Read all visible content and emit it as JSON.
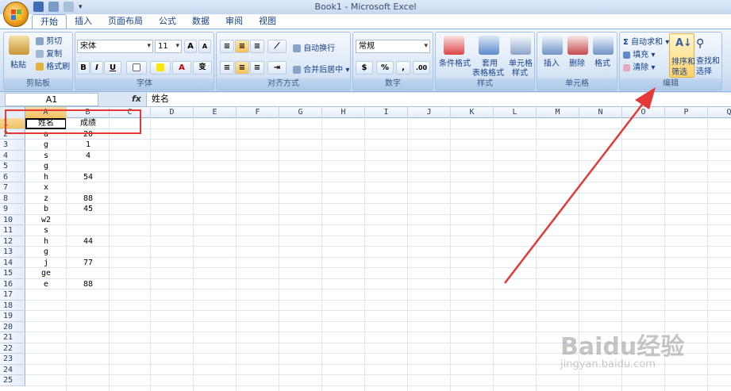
{
  "window": {
    "title": "Book1 - Microsoft Excel"
  },
  "tabs": [
    "开始",
    "插入",
    "页面布局",
    "公式",
    "数据",
    "审阅",
    "视图"
  ],
  "ribbon": {
    "clipboard": {
      "label": "剪贴板",
      "paste": "粘贴",
      "cut": "剪切",
      "copy": "复制",
      "format_painter": "格式刷"
    },
    "font": {
      "label": "字体",
      "font_name": "宋体",
      "font_size": "11",
      "bold": "B",
      "italic": "I",
      "underline": "U",
      "grow": "A",
      "shrink": "A",
      "phonetic": "变"
    },
    "alignment": {
      "label": "对齐方式",
      "wrap": "自动换行",
      "merge": "合并后居中"
    },
    "number": {
      "label": "数字",
      "format": "常规",
      "percent": "%",
      "comma": ","
    },
    "styles": {
      "label": "样式",
      "cond": "条件格式",
      "table1": "套用",
      "table2": "表格格式",
      "cell1": "单元格",
      "cell2": "样式"
    },
    "cells": {
      "label": "单元格",
      "insert": "插入",
      "delete": "删除",
      "format": "格式"
    },
    "editing": {
      "label": "编辑",
      "autosum": "自动求和",
      "fill": "填充",
      "clear": "清除",
      "sort1": "排序和",
      "sort2": "筛选",
      "find1": "查找和",
      "find2": "选择"
    }
  },
  "formula_bar": {
    "name_box": "A1",
    "fx": "fx",
    "content": "姓名"
  },
  "columns": [
    "A",
    "B",
    "C",
    "D",
    "E",
    "F",
    "G",
    "H",
    "I",
    "J",
    "K",
    "L",
    "M",
    "N",
    "O",
    "P",
    "Q"
  ],
  "rows": [
    [
      "姓名",
      "成绩"
    ],
    [
      "a",
      "20"
    ],
    [
      "g",
      "1"
    ],
    [
      "s",
      "4"
    ],
    [
      "g",
      ""
    ],
    [
      "h",
      "54"
    ],
    [
      "x",
      ""
    ],
    [
      "z",
      "88"
    ],
    [
      "b",
      "45"
    ],
    [
      "w2",
      ""
    ],
    [
      "s",
      ""
    ],
    [
      "h",
      "44"
    ],
    [
      "g",
      ""
    ],
    [
      "j",
      "77"
    ],
    [
      "ge",
      ""
    ],
    [
      "e",
      "88"
    ],
    [
      "",
      ""
    ],
    [
      "",
      ""
    ],
    [
      "",
      ""
    ],
    [
      "",
      ""
    ],
    [
      "",
      ""
    ],
    [
      "",
      ""
    ],
    [
      "",
      ""
    ],
    [
      "",
      ""
    ],
    [
      "",
      ""
    ]
  ],
  "watermark": {
    "brand": "Baidu经验",
    "url": "jingyan.baidu.com"
  },
  "colors": {
    "annotation": "#e53935",
    "selected_header": "#f1c15f"
  }
}
